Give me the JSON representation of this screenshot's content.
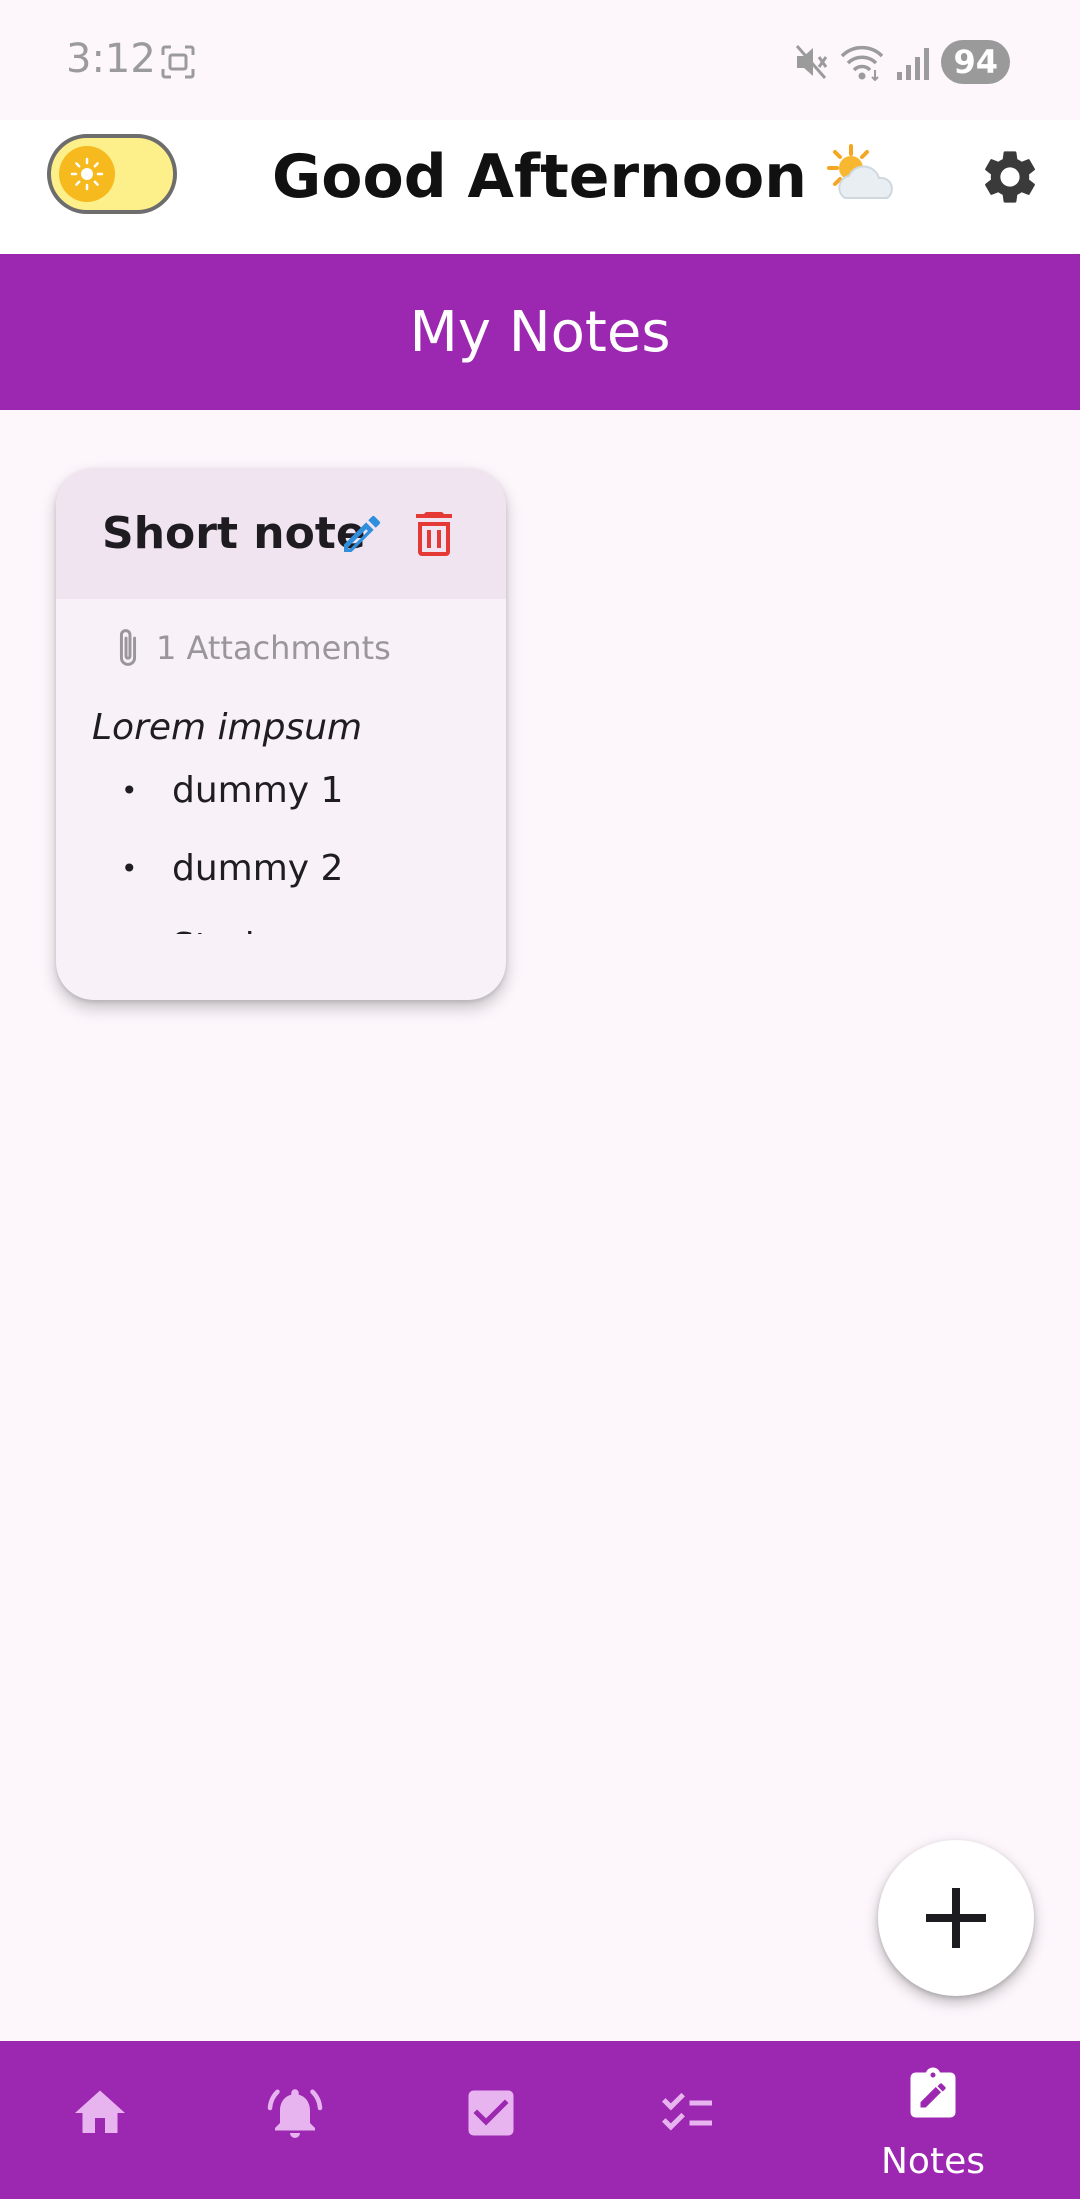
{
  "status_bar": {
    "time": "3:12",
    "battery": "94",
    "icons": [
      "screenshot-icon",
      "mute-icon",
      "wifi-icon",
      "signal-icon"
    ]
  },
  "header": {
    "greeting": "Good Afternoon",
    "greeting_emoji": "sun-behind-cloud-emoji",
    "theme_toggle_on": true,
    "settings_icon": "gear-icon"
  },
  "title_bar": {
    "title": "My Notes"
  },
  "notes": [
    {
      "title": "Short note",
      "attachments_label": "1 Attachments",
      "body_first_line": "Lorem impsum",
      "bullets": [
        "dummy 1",
        "dummy 2"
      ],
      "numbered": [
        "Study"
      ]
    }
  ],
  "bottom_nav": {
    "items": [
      {
        "icon": "home-icon",
        "label": ""
      },
      {
        "icon": "alarm-bell-icon",
        "label": ""
      },
      {
        "icon": "checkbox-icon",
        "label": ""
      },
      {
        "icon": "checklist-icon",
        "label": ""
      },
      {
        "icon": "note-edit-icon",
        "label": "Notes"
      }
    ],
    "active": "Notes"
  },
  "colors": {
    "primary": "#9c27b0",
    "background": "#fdf7fc",
    "card_header": "#f1e4f1",
    "edit_icon": "#2f8fdd",
    "delete_icon": "#e53935",
    "toggle_track": "#fdf08a",
    "toggle_knob": "#f6b91e",
    "nav_icon_inactive": "#e7b4ef"
  }
}
